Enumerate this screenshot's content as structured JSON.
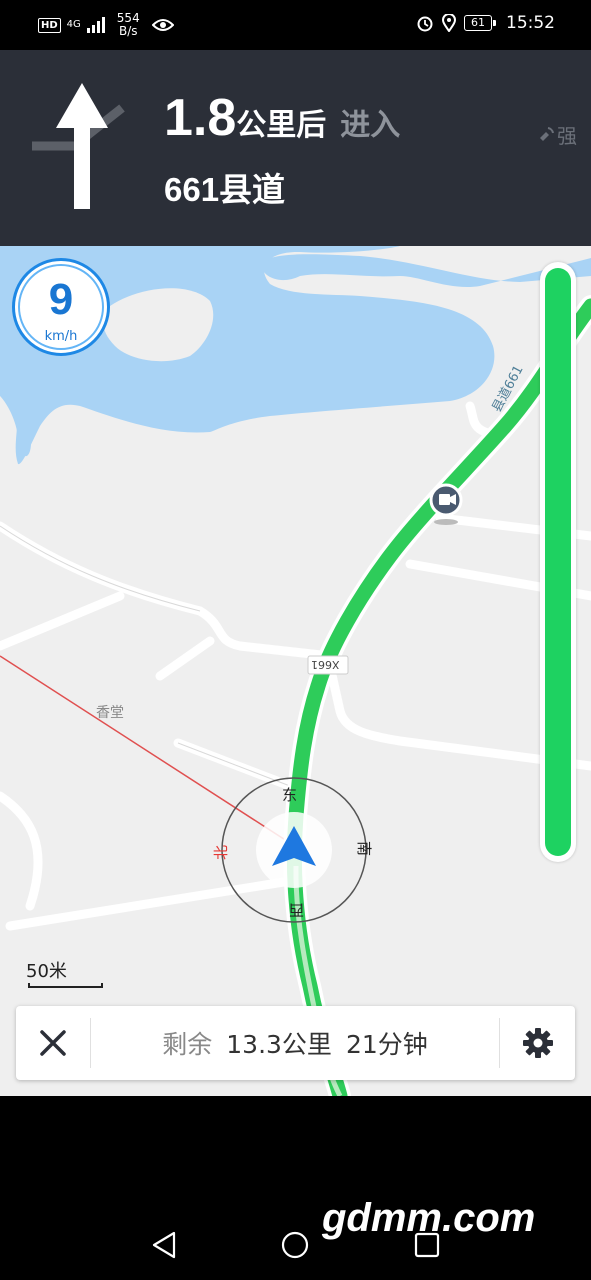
{
  "status_bar": {
    "hd": "HD",
    "network": "4G",
    "speed_top": "554",
    "speed_bottom": "B/s",
    "battery": "61",
    "time": "15:52"
  },
  "guidance": {
    "distance_value": "1.8",
    "distance_unit": "公里后",
    "action": "进入",
    "road": "661县道",
    "signal": "强",
    "turn_icon": "straight-arrow-icon"
  },
  "speed": {
    "value": "9",
    "unit": "km/h"
  },
  "map": {
    "poi_label": "香堂",
    "road_sign": "X661",
    "road_label": "县道661",
    "compass": {
      "east": "东",
      "south": "南",
      "west": "西",
      "north": "北"
    }
  },
  "scale": {
    "label": "50米"
  },
  "summary": {
    "label": "剩余",
    "distance": "13.3公里",
    "time": "21分钟"
  },
  "colors": {
    "header_bg": "#2b2f38",
    "route": "#2ecc5a",
    "water": "#a9d3f5",
    "speed_ring": "#1e88e5"
  },
  "watermark": "gdmm.com"
}
